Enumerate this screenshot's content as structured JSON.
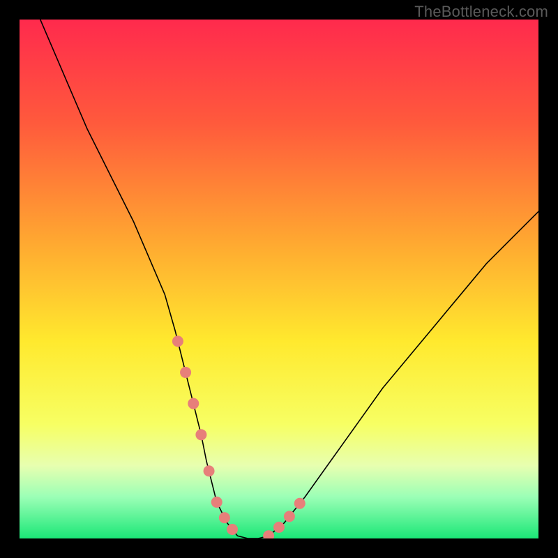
{
  "watermark": "TheBottleneck.com",
  "colors": {
    "page_bg": "#000000",
    "curve": "#000000",
    "marker": "#e77f7a",
    "gradient_stops": [
      {
        "offset": "0%",
        "color": "#ff2a4d"
      },
      {
        "offset": "20%",
        "color": "#ff5a3c"
      },
      {
        "offset": "42%",
        "color": "#ffa531"
      },
      {
        "offset": "62%",
        "color": "#ffe92e"
      },
      {
        "offset": "78%",
        "color": "#f7ff63"
      },
      {
        "offset": "86%",
        "color": "#e7ffb0"
      },
      {
        "offset": "92%",
        "color": "#9bffb6"
      },
      {
        "offset": "100%",
        "color": "#1be777"
      }
    ]
  },
  "chart_data": {
    "type": "line",
    "title": "",
    "xlabel": "",
    "ylabel": "",
    "xlim": [
      0,
      100
    ],
    "ylim": [
      0,
      100
    ],
    "x": [
      4,
      7,
      10,
      13,
      16,
      19,
      22,
      25,
      28,
      30,
      32,
      34,
      35,
      36,
      37,
      38,
      40,
      42,
      44,
      46,
      48,
      51,
      55,
      60,
      65,
      70,
      75,
      80,
      85,
      90,
      95,
      100
    ],
    "values": [
      100,
      93,
      86,
      79,
      73,
      67,
      61,
      54,
      47,
      40,
      32,
      24,
      20,
      15,
      11,
      7,
      3,
      0.5,
      0,
      0,
      0.5,
      3,
      8,
      15,
      22,
      29,
      35,
      41,
      47,
      53,
      58,
      63
    ],
    "marker_ranges": [
      {
        "x_from": 30.5,
        "x_to": 41.0
      },
      {
        "x_from": 48.0,
        "x_to": 54.0
      }
    ],
    "marker_radius_px": 8
  }
}
